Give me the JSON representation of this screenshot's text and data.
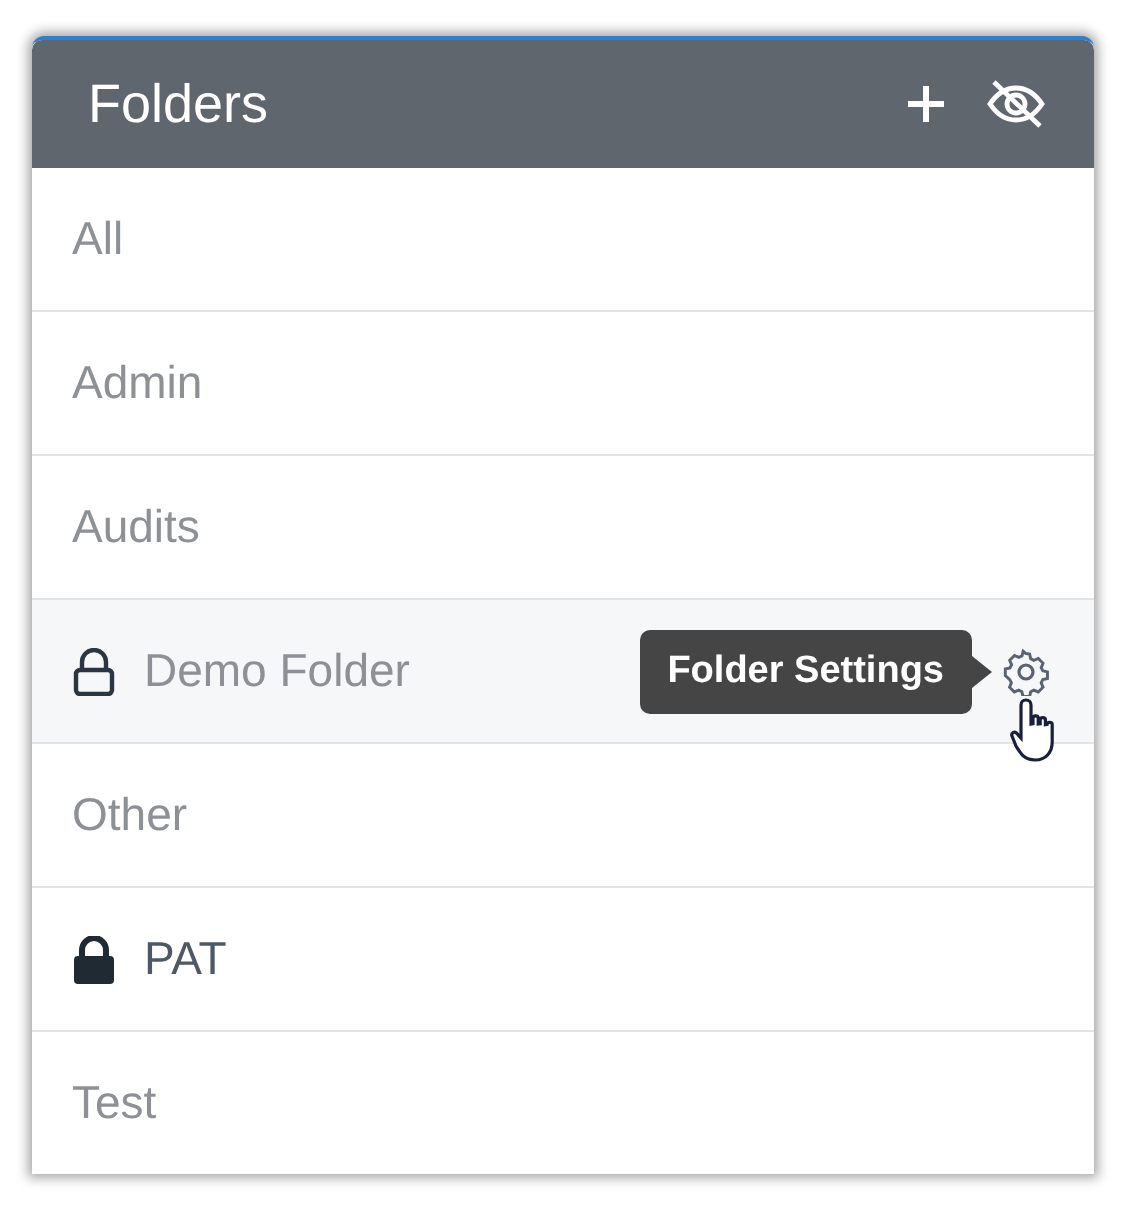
{
  "header": {
    "title": "Folders"
  },
  "folders": [
    {
      "name": "All",
      "kind": "plain",
      "selected": false,
      "hovered": false
    },
    {
      "name": "Admin",
      "kind": "plain",
      "selected": false,
      "hovered": false
    },
    {
      "name": "Audits",
      "kind": "plain",
      "selected": false,
      "hovered": false
    },
    {
      "name": "Demo Folder",
      "kind": "outlined",
      "selected": false,
      "hovered": true,
      "tooltip": "Folder Settings"
    },
    {
      "name": "Other",
      "kind": "plain",
      "selected": false,
      "hovered": false
    },
    {
      "name": "PAT",
      "kind": "locked",
      "selected": true,
      "hovered": false
    },
    {
      "name": "Test",
      "kind": "plain",
      "selected": false,
      "hovered": false
    }
  ]
}
